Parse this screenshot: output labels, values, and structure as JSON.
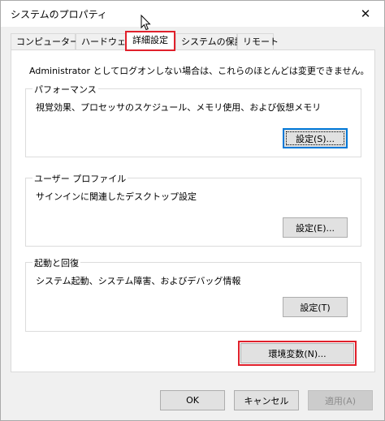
{
  "window": {
    "title": "システムのプロパティ",
    "close_glyph": "✕"
  },
  "tabs": [
    {
      "label": "コンピューター名"
    },
    {
      "label": "ハードウェア"
    },
    {
      "label": "詳細設定"
    },
    {
      "label": "システムの保護"
    },
    {
      "label": "リモート"
    }
  ],
  "active_tab": "詳細設定",
  "notice": "Administrator としてログオンしない場合は、これらのほとんどは変更できません。",
  "performance": {
    "title": "パフォーマンス",
    "description": "視覚効果、プロセッサのスケジュール、メモリ使用、および仮想メモリ",
    "button": "設定(S)..."
  },
  "user_profile": {
    "title": "ユーザー プロファイル",
    "description": "サインインに関連したデスクトップ設定",
    "button": "設定(E)..."
  },
  "startup": {
    "title": "起動と回復",
    "description": "システム起動、システム障害、およびデバッグ情報",
    "button": "設定(T)"
  },
  "env_button": "環境変数(N)...",
  "footer": {
    "ok": "OK",
    "cancel": "キャンセル",
    "apply": "適用(A)"
  },
  "colors": {
    "highlight": "#e0202b",
    "focus": "#0078d7"
  }
}
